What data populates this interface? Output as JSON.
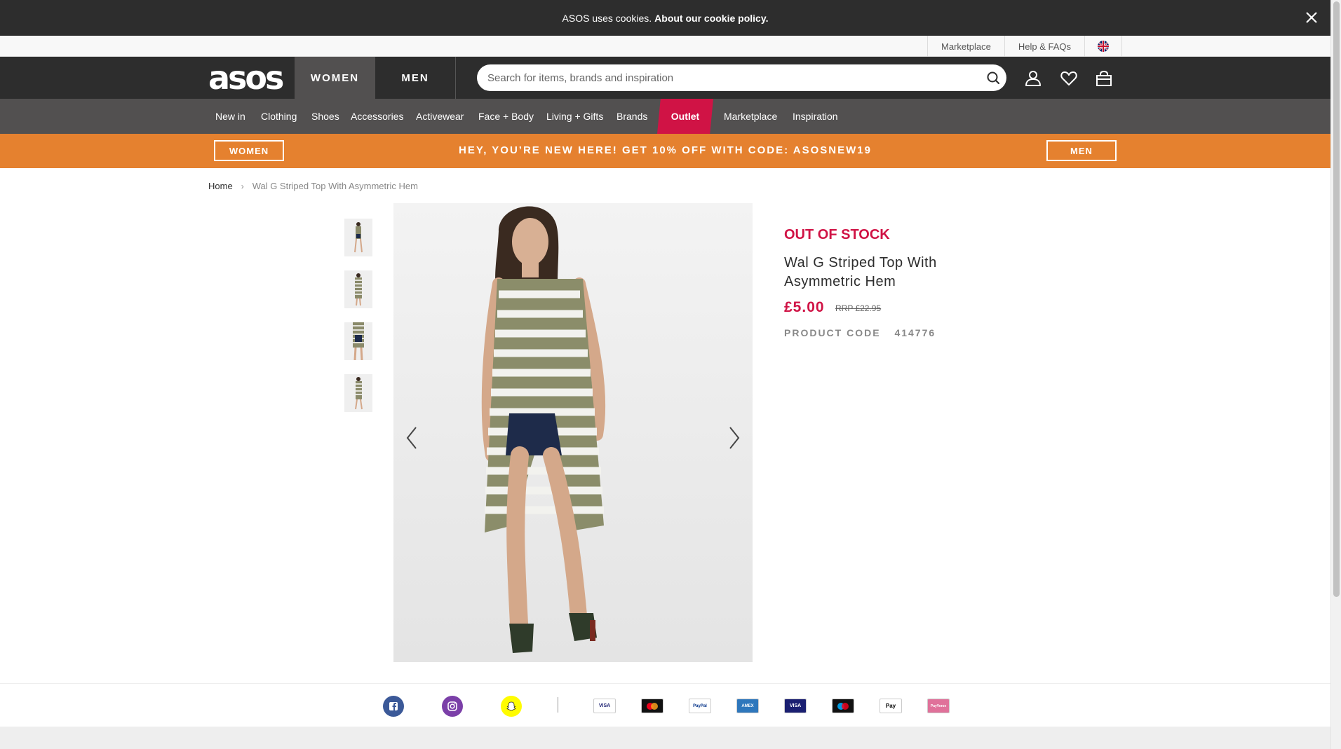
{
  "cookie_banner": {
    "text": "ASOS uses cookies.",
    "link": "About our cookie policy.",
    "close_icon": "close-icon"
  },
  "utility_bar": {
    "marketplace": "Marketplace",
    "help": "Help & FAQs",
    "flag_icon": "uk-flag-icon"
  },
  "header": {
    "logo": "asos",
    "tab_women": "WOMEN",
    "tab_men": "MEN",
    "search_placeholder": "Search for items, brands and inspiration",
    "icons": [
      "search-icon",
      "account-icon",
      "heart-icon",
      "bag-icon"
    ]
  },
  "categories": [
    "New in",
    "Clothing",
    "Shoes",
    "Accessories",
    "Activewear",
    "Face + Body",
    "Living + Gifts",
    "Brands",
    "Outlet",
    "Marketplace",
    "Inspiration"
  ],
  "promo": {
    "left_button": "WOMEN",
    "text": "HEY, YOU’RE NEW HERE! GET 10% OFF WITH CODE: ASOSNEW19",
    "right_button": "MEN"
  },
  "breadcrumb": {
    "home": "Home",
    "separator": "›",
    "current": "Wal G Striped Top With Asymmetric Hem"
  },
  "product": {
    "stock_status": "OUT OF STOCK",
    "name": "Wal G Striped Top With Asymmetric Hem",
    "price": "£5.00",
    "rrp": "RRP £22.95",
    "code_label": "PRODUCT CODE",
    "code_value": "414776"
  },
  "footer": {
    "social": [
      "facebook-icon",
      "instagram-icon",
      "snapchat-icon"
    ],
    "payments": [
      "VISA",
      "mastercard",
      "PayPal",
      "AMEX",
      "VISA",
      "maestro",
      "Pay",
      "PayVerse"
    ]
  },
  "colors": {
    "dark": "#2d2d2d",
    "nav_grey": "#525050",
    "accent_red": "#d01345",
    "promo_orange": "#e5812f"
  }
}
